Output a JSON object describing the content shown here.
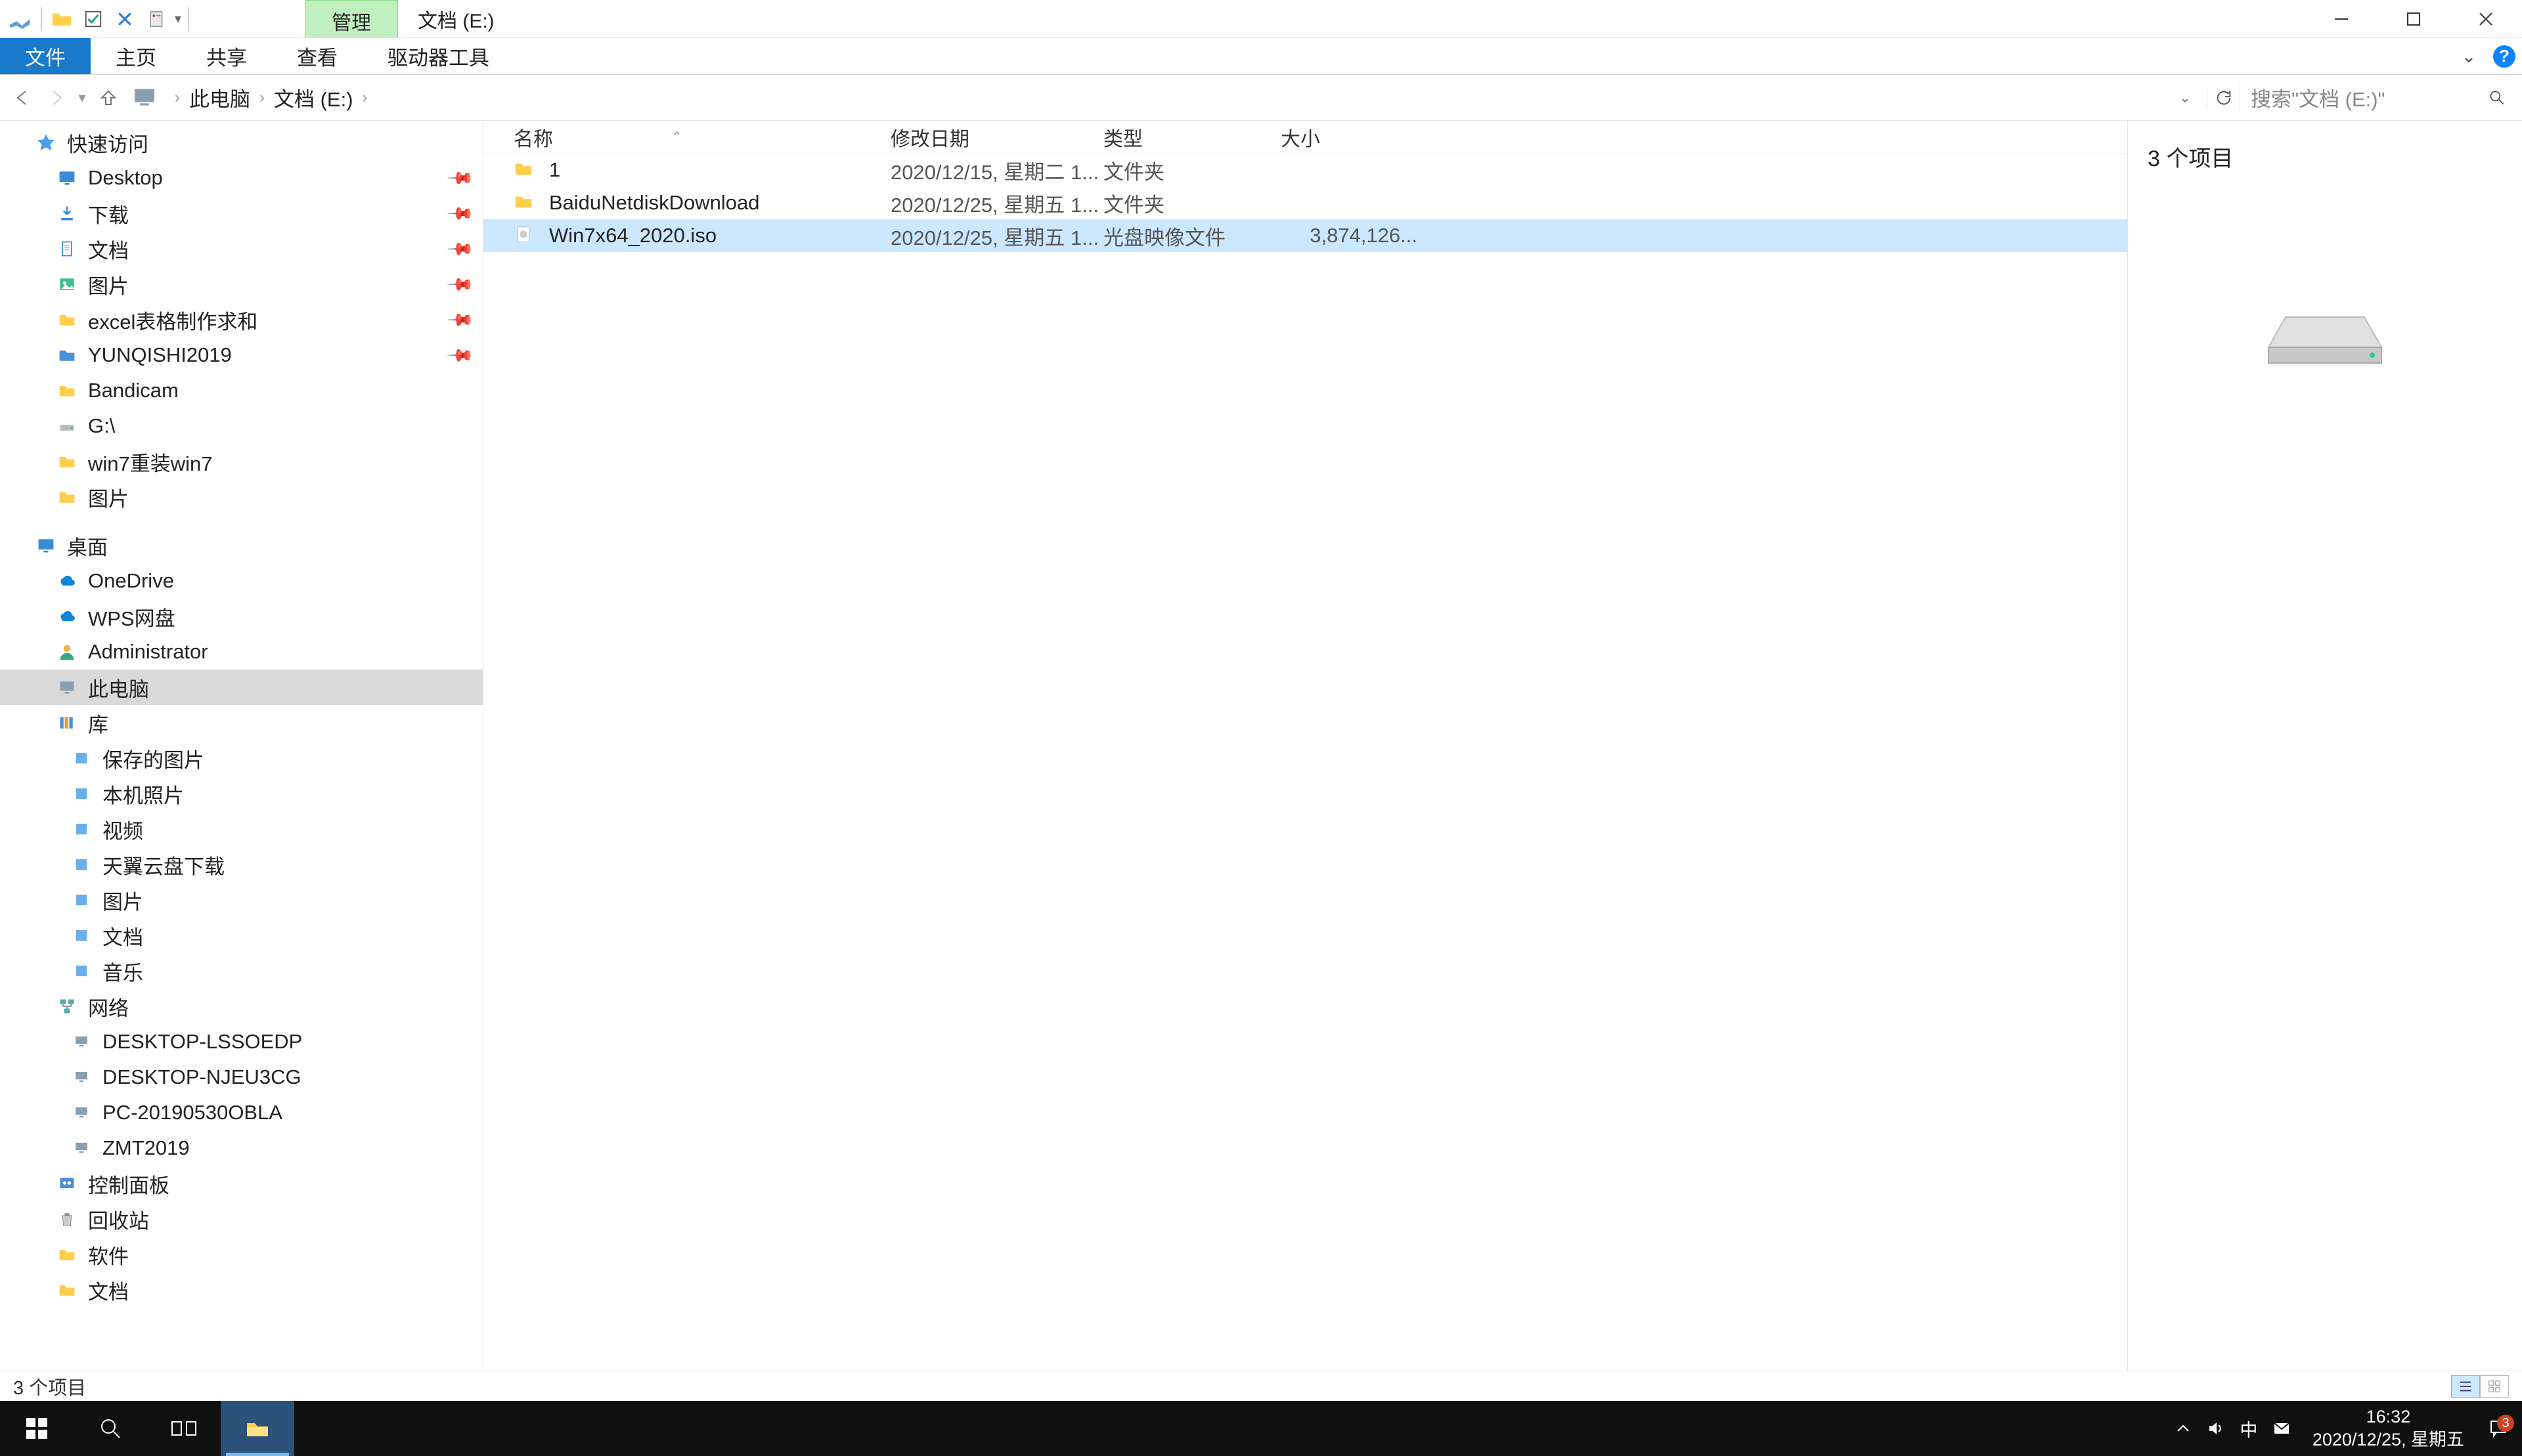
{
  "titlebar": {
    "manage_tab": "管理",
    "location": "文档 (E:)"
  },
  "ribbon": {
    "file": "文件",
    "home": "主页",
    "share": "共享",
    "view": "查看",
    "drive_tools": "驱动器工具"
  },
  "breadcrumb": {
    "this_pc": "此电脑",
    "drive": "文档 (E:)"
  },
  "search": {
    "placeholder": "搜索\"文档 (E:)\""
  },
  "nav": {
    "quick_access": "快速访问",
    "items_qa": [
      {
        "label": "Desktop",
        "icon": "desktop",
        "pinned": true
      },
      {
        "label": "下载",
        "icon": "download",
        "pinned": true
      },
      {
        "label": "文档",
        "icon": "doc",
        "pinned": true
      },
      {
        "label": "图片",
        "icon": "pictures",
        "pinned": true
      },
      {
        "label": "excel表格制作求和",
        "icon": "folder",
        "pinned": true
      },
      {
        "label": "YUNQISHI2019",
        "icon": "folder-blue",
        "pinned": true
      },
      {
        "label": "Bandicam",
        "icon": "folder",
        "pinned": false
      },
      {
        "label": "G:\\",
        "icon": "drive-usb",
        "pinned": false
      },
      {
        "label": "win7重装win7",
        "icon": "folder",
        "pinned": false
      },
      {
        "label": "图片",
        "icon": "folder",
        "pinned": false
      }
    ],
    "desktop": "桌面",
    "onedrive": "OneDrive",
    "wps": "WPS网盘",
    "admin": "Administrator",
    "this_pc": "此电脑",
    "libraries": "库",
    "lib_items": [
      {
        "label": "保存的图片"
      },
      {
        "label": "本机照片"
      },
      {
        "label": "视频"
      },
      {
        "label": "天翼云盘下载"
      },
      {
        "label": "图片"
      },
      {
        "label": "文档"
      },
      {
        "label": "音乐"
      }
    ],
    "network": "网络",
    "net_items": [
      {
        "label": "DESKTOP-LSSOEDP"
      },
      {
        "label": "DESKTOP-NJEU3CG"
      },
      {
        "label": "PC-20190530OBLA"
      },
      {
        "label": "ZMT2019"
      }
    ],
    "control_panel": "控制面板",
    "recycle": "回收站",
    "software": "软件",
    "docs": "文档"
  },
  "columns": {
    "name": "名称",
    "date": "修改日期",
    "type": "类型",
    "size": "大小"
  },
  "files": [
    {
      "name": "1",
      "date": "2020/12/15, 星期二 1...",
      "type": "文件夹",
      "size": "",
      "icon": "folder",
      "selected": false
    },
    {
      "name": "BaiduNetdiskDownload",
      "date": "2020/12/25, 星期五 1...",
      "type": "文件夹",
      "size": "",
      "icon": "folder",
      "selected": false
    },
    {
      "name": "Win7x64_2020.iso",
      "date": "2020/12/25, 星期五 1...",
      "type": "光盘映像文件",
      "size": "3,874,126...",
      "icon": "iso",
      "selected": true
    }
  ],
  "preview": {
    "count_text": "3 个项目"
  },
  "status": {
    "text": "3 个项目"
  },
  "taskbar": {
    "time": "16:32",
    "date": "2020/12/25, 星期五",
    "ime": "中",
    "notif_count": "3"
  }
}
